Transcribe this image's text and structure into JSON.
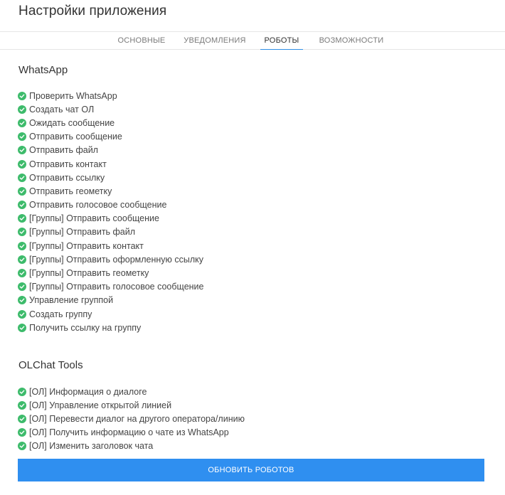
{
  "app_title": "Настройки приложения",
  "tabs": [
    {
      "label": "ОСНОВНЫЕ",
      "active": false
    },
    {
      "label": "УВЕДОМЛЕНИЯ",
      "active": false
    },
    {
      "label": "РОБОТЫ",
      "active": true
    },
    {
      "label": "ВОЗМОЖНОСТИ",
      "active": false
    }
  ],
  "colors": {
    "accent": "#2f8ff0",
    "check": "#3dbb6b",
    "tab_underline": "#2f8fe5"
  },
  "sections": [
    {
      "title": "WhatsApp",
      "icon": "check-circle-icon",
      "items": [
        "Проверить WhatsApp",
        "Создать чат ОЛ",
        "Ожидать сообщение",
        "Отправить сообщение",
        "Отправить файл",
        "Отправить контакт",
        "Отправить ссылку",
        "Отправить геометку",
        "Отправить голосовое сообщение",
        "[Группы] Отправить сообщение",
        "[Группы] Отправить файл",
        "[Группы] Отправить контакт",
        "[Группы] Отправить оформленную ссылку",
        "[Группы] Отправить геометку",
        "[Группы] Отправить голосовое сообщение",
        "Управление группой",
        "Создать группу",
        "Получить ссылку на группу"
      ]
    },
    {
      "title": "OLChat Tools",
      "icon": "check-circle-icon",
      "items": [
        "[ОЛ] Информация о диалоге",
        "[ОЛ] Управление открытой линией",
        "[ОЛ] Перевести диалог на другого оператора/линию",
        "[ОЛ] Получить информацию о чате из WhatsApp",
        "[ОЛ] Изменить заголовок чата"
      ]
    }
  ],
  "update_button_label": "ОБНОВИТЬ РОБОТОВ"
}
